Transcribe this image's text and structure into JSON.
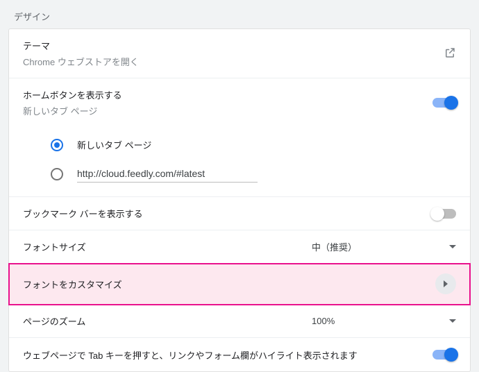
{
  "section": {
    "title": "デザイン"
  },
  "theme": {
    "label": "テーマ",
    "sub": "Chrome ウェブストアを開く"
  },
  "home_button": {
    "label": "ホームボタンを表示する",
    "sub": "新しいタブ ページ",
    "on": true,
    "option_newtab": "新しいタブ ページ",
    "option_url_value": "http://cloud.feedly.com/#latest"
  },
  "bookmarks_bar": {
    "label": "ブックマーク バーを表示する",
    "on": false
  },
  "font_size": {
    "label": "フォントサイズ",
    "value": "中（推奨）"
  },
  "customize_fonts": {
    "label": "フォントをカスタマイズ"
  },
  "page_zoom": {
    "label": "ページのズーム",
    "value": "100%"
  },
  "tab_highlight": {
    "label": "ウェブページで Tab キーを押すと、リンクやフォーム欄がハイライト表示されます",
    "on": true
  }
}
